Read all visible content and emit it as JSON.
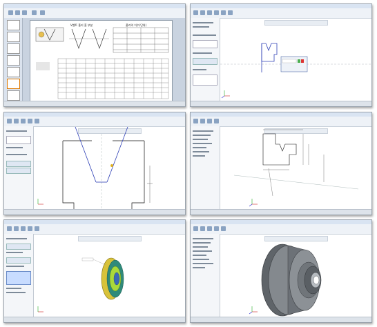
{
  "panels": [
    {
      "id": "powerpoint",
      "app": "PowerPoint"
    },
    {
      "id": "sketch-profile",
      "app": "SolidWorks"
    },
    {
      "id": "sketch-zoom",
      "app": "SolidWorks"
    },
    {
      "id": "sketch-dimensions",
      "app": "SolidWorks"
    },
    {
      "id": "revolve-preview",
      "app": "SolidWorks"
    },
    {
      "id": "pulley-model",
      "app": "SolidWorks"
    }
  ],
  "ppt": {
    "slide_title": "V벨트 풀리 홈 부분",
    "table_title": "풀리의 치수(단위)"
  },
  "colors": {
    "accent": "#2f4f8a",
    "sketch_blue": "#2d3fb5",
    "model_gray": "#6e7378",
    "highlight_green": "#a9d93b"
  }
}
